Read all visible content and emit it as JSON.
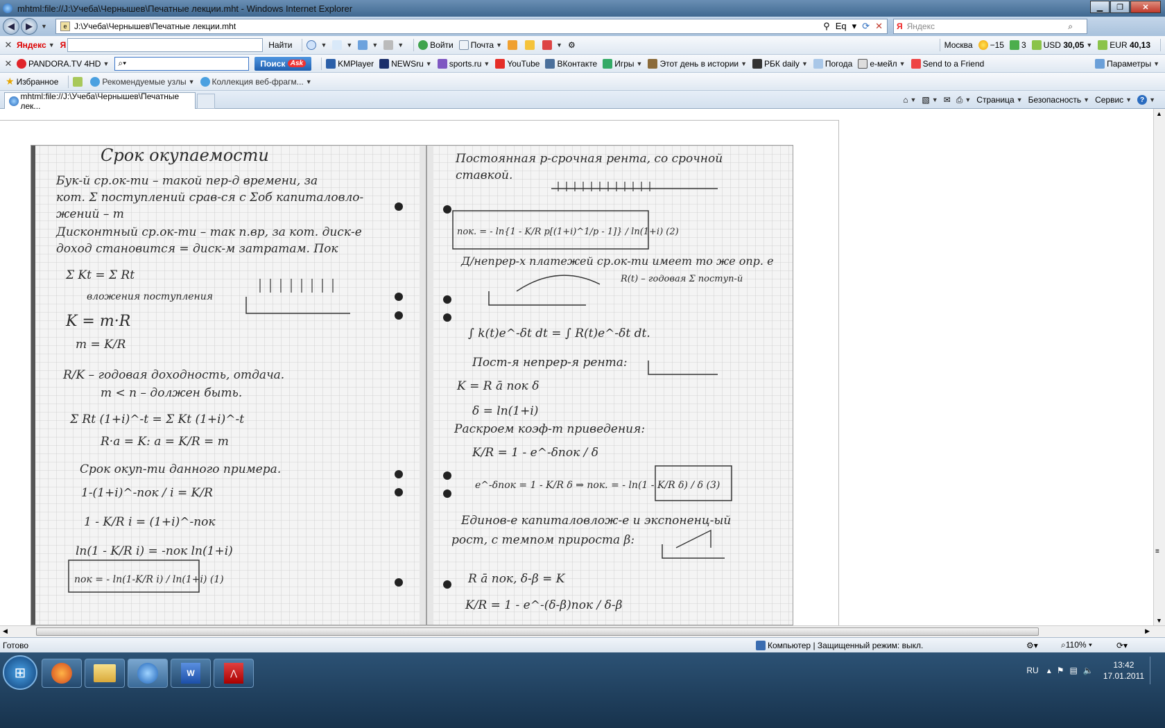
{
  "window": {
    "title": "mhtml:file://J:\\Учеба\\Чернышев\\Печатные лекции.mht - Windows Internet Explorer",
    "minimize": "▁",
    "maximize": "❐",
    "close": "✕"
  },
  "address": {
    "url": "J:\\Учеба\\Чернышев\\Печатные лекции.mht",
    "search_placeholder": "Яндекс"
  },
  "yandex_bar": {
    "brand": "Яндекс",
    "find": "Найти",
    "login": "Войти",
    "mail": "Почта",
    "city": "Москва",
    "temp": "−15",
    "traffic": "3",
    "usd_label": "USD",
    "usd": "30,05",
    "eur_label": "EUR",
    "eur": "40,13"
  },
  "pandora_bar": {
    "brand": "PANDORA.TV 4HD",
    "search_btn": "Поиск",
    "ask": "Ask",
    "items": [
      "KMPlayer",
      "NEWSru",
      "sports.ru",
      "YouTube",
      "ВКонтакте",
      "Игры",
      "Этот день в истории",
      "РБК daily",
      "Погода",
      "e-мейл",
      "Send to a Friend"
    ],
    "params": "Параметры"
  },
  "favorites": {
    "label": "Избранное",
    "suggested": "Рекомендуемые узлы",
    "gallery": "Коллекция веб-фрагм..."
  },
  "tab": {
    "title": "mhtml:file://J:\\Учеба\\Чернышев\\Печатные лек..."
  },
  "commands": {
    "page": "Страница",
    "safety": "Безопасность",
    "tools": "Сервис"
  },
  "status": {
    "text": "Готово",
    "zone": "Компьютер | Защищенный режим: выкл.",
    "zoom": "110%"
  },
  "taskbar": {
    "lang": "RU",
    "time": "13:42",
    "date": "17.01.2011"
  },
  "notes_left": [
    "Срок окупаемости",
    "Бук-й ср.ок-ти – такой пер-д времени, за",
    "кот. Σ поступлений срав-ся с Σоб капиталовло-",
    "жений – m",
    "Дисконтный ср.ок-ти – так п.вр, за кот. диск-е",
    "доход становится = диск-м затратам. Пок",
    "Σ Kt = Σ Rt",
    "вложения   поступления",
    "K = m·R",
    "m = K/R",
    "R/K – годовая доходность, отдача.",
    "m < n – должен быть.",
    "Σ Rt (1+i)^-t = Σ Kt (1+i)^-t",
    "R·a = K: a = K/R = m",
    "Срок окуп-ти данного примера.",
    "1-(1+i)^-пок / i = K/R",
    "1 - K/R i = (1+i)^-пок",
    "ln(1 - K/R i) = -пок ln(1+i)",
    "пок = - ln(1-K/R i) / ln(1+i)   (1)"
  ],
  "notes_right": [
    "Постоянная p-срочная рента, со срочной",
    "ставкой.",
    "пок. = - ln{1 - K/R p[(1+i)^1/p - 1]} / ln(1+i)   (2)",
    "Д/непрер-х платежей ср.ок-ти имеет то же опр. е",
    "R(t) – годовая Σ поступ-й",
    "∫ k(t)e^-δt dt = ∫ R(t)e^-δt dt.",
    "Пост-я непрер-я рента:",
    "K = R ā пок δ",
    "δ = ln(1+i)",
    "Раскроем коэф-т приведения:",
    "K/R = 1 - e^-δпок / δ",
    "e^-δпок = 1 - K/R δ ⇒ пок. = - ln(1 - K/R δ) / δ   (3)",
    "Единов-е капиталовлож-е и экспоненц-ый",
    "рост, с темпом прироста β:",
    "R ā пок, δ-β = K",
    "K/R = 1 - e^-(δ-β)пок / δ-β"
  ]
}
